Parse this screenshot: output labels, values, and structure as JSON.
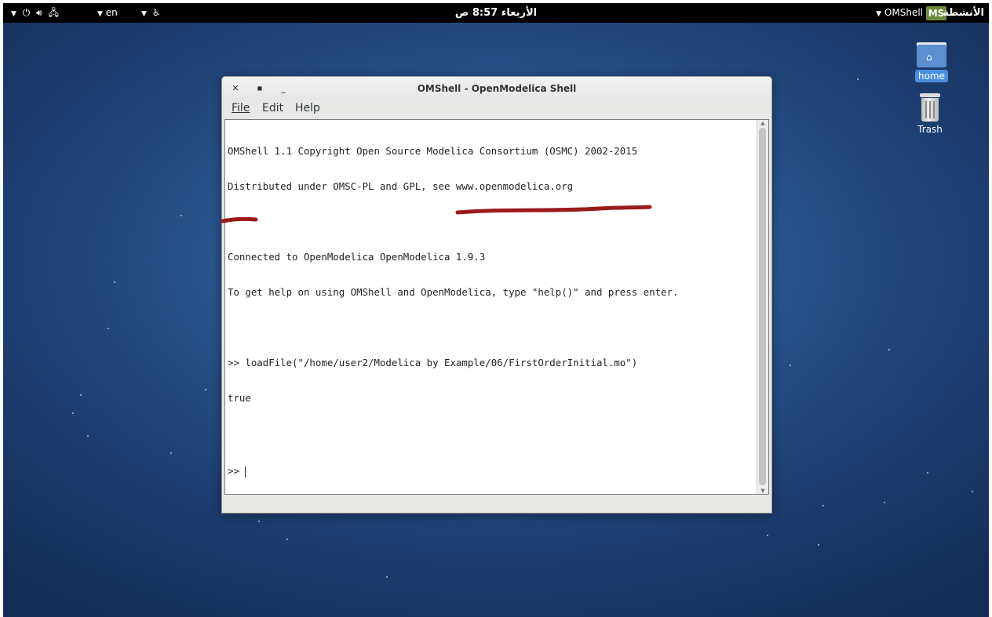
{
  "topbar": {
    "language": "en",
    "clock": "الأربعاء 8:57 ص",
    "app_menu": "OMShell",
    "app_icon_text": "MS",
    "activities": "الأنشطة"
  },
  "desktop": {
    "icons": [
      {
        "label": "home",
        "icon": "home-folder-icon",
        "selected": true
      },
      {
        "label": "Trash",
        "icon": "trash-icon",
        "selected": false
      }
    ]
  },
  "window": {
    "title": "OMShell - OpenModelica Shell",
    "menu": [
      "File",
      "Edit",
      "Help"
    ],
    "console": {
      "lines": [
        "OMShell 1.1 Copyright Open Source Modelica Consortium (OSMC) 2002-2015",
        "Distributed under OMSC-PL and GPL, see www.openmodelica.org",
        "",
        "Connected to OpenModelica OpenModelica 1.9.3",
        "To get help on using OMShell and OpenModelica, type \"help()\" and press enter.",
        "",
        ">> loadFile(\"/home/user2/Modelica by Example/06/FirstOrderInitial.mo\")",
        "true",
        "",
        ">> "
      ]
    }
  },
  "colors": {
    "annotation": "#9b1a1a",
    "selection": "#4a8ee0"
  }
}
